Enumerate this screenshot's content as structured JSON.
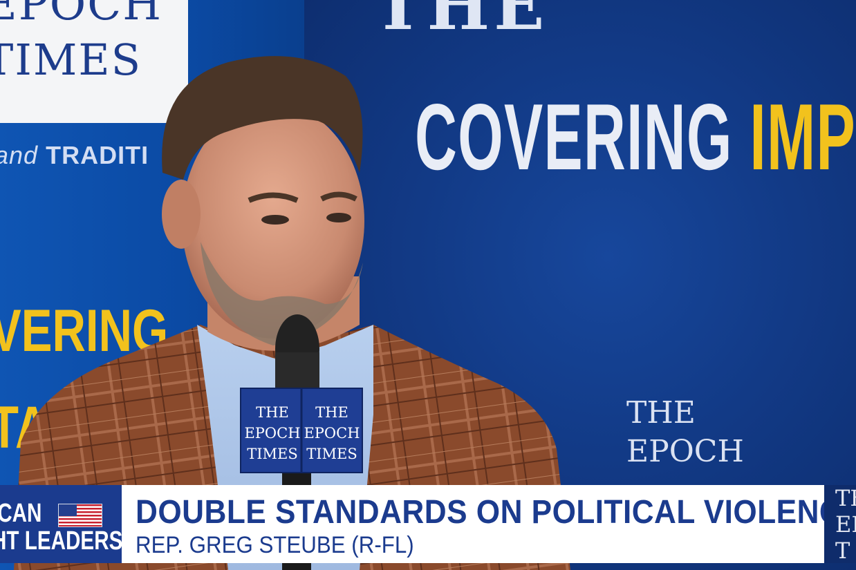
{
  "backdrop": {
    "left_logo_line1": "EPOCH",
    "left_logo_line2": "TIMES",
    "left_tagline_a": "and",
    "left_tagline_b": "TRADITI",
    "left_cover_1": "VERING",
    "left_cover_2": "TA",
    "top_serif": "THE",
    "cover_white": "COVERING",
    "cover_yellow": "IMPORT",
    "right_logo": "THE\nEPOCH"
  },
  "microphone": {
    "flag_left": "THE\nEPOCH\nTIMES",
    "flag_right": "THE\nEPOCH\nTIMES"
  },
  "lower_third": {
    "show_line1": "ICAN",
    "show_line2": "HT LEADERS",
    "headline": "DOUBLE STANDARDS ON POLITICAL VIOLENCE",
    "subtitle": "REP. GREG STEUBE (R-FL)",
    "right_logo": "TH\nEP\nT"
  },
  "colors": {
    "brand_navy": "#1b3b8e",
    "backdrop_blue": "#123a86",
    "gold": "#f2c21d",
    "white": "#ffffff"
  }
}
